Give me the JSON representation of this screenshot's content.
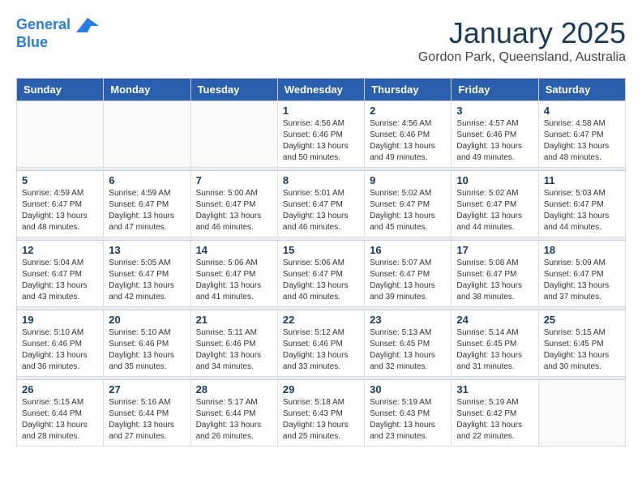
{
  "logo": {
    "line1": "General",
    "line2": "Blue"
  },
  "title": "January 2025",
  "subtitle": "Gordon Park, Queensland, Australia",
  "days_of_week": [
    "Sunday",
    "Monday",
    "Tuesday",
    "Wednesday",
    "Thursday",
    "Friday",
    "Saturday"
  ],
  "weeks": [
    [
      {
        "day": "",
        "info": ""
      },
      {
        "day": "",
        "info": ""
      },
      {
        "day": "",
        "info": ""
      },
      {
        "day": "1",
        "info": "Sunrise: 4:56 AM\nSunset: 6:46 PM\nDaylight: 13 hours\nand 50 minutes."
      },
      {
        "day": "2",
        "info": "Sunrise: 4:56 AM\nSunset: 6:46 PM\nDaylight: 13 hours\nand 49 minutes."
      },
      {
        "day": "3",
        "info": "Sunrise: 4:57 AM\nSunset: 6:46 PM\nDaylight: 13 hours\nand 49 minutes."
      },
      {
        "day": "4",
        "info": "Sunrise: 4:58 AM\nSunset: 6:47 PM\nDaylight: 13 hours\nand 48 minutes."
      }
    ],
    [
      {
        "day": "5",
        "info": "Sunrise: 4:59 AM\nSunset: 6:47 PM\nDaylight: 13 hours\nand 48 minutes."
      },
      {
        "day": "6",
        "info": "Sunrise: 4:59 AM\nSunset: 6:47 PM\nDaylight: 13 hours\nand 47 minutes."
      },
      {
        "day": "7",
        "info": "Sunrise: 5:00 AM\nSunset: 6:47 PM\nDaylight: 13 hours\nand 46 minutes."
      },
      {
        "day": "8",
        "info": "Sunrise: 5:01 AM\nSunset: 6:47 PM\nDaylight: 13 hours\nand 46 minutes."
      },
      {
        "day": "9",
        "info": "Sunrise: 5:02 AM\nSunset: 6:47 PM\nDaylight: 13 hours\nand 45 minutes."
      },
      {
        "day": "10",
        "info": "Sunrise: 5:02 AM\nSunset: 6:47 PM\nDaylight: 13 hours\nand 44 minutes."
      },
      {
        "day": "11",
        "info": "Sunrise: 5:03 AM\nSunset: 6:47 PM\nDaylight: 13 hours\nand 44 minutes."
      }
    ],
    [
      {
        "day": "12",
        "info": "Sunrise: 5:04 AM\nSunset: 6:47 PM\nDaylight: 13 hours\nand 43 minutes."
      },
      {
        "day": "13",
        "info": "Sunrise: 5:05 AM\nSunset: 6:47 PM\nDaylight: 13 hours\nand 42 minutes."
      },
      {
        "day": "14",
        "info": "Sunrise: 5:06 AM\nSunset: 6:47 PM\nDaylight: 13 hours\nand 41 minutes."
      },
      {
        "day": "15",
        "info": "Sunrise: 5:06 AM\nSunset: 6:47 PM\nDaylight: 13 hours\nand 40 minutes."
      },
      {
        "day": "16",
        "info": "Sunrise: 5:07 AM\nSunset: 6:47 PM\nDaylight: 13 hours\nand 39 minutes."
      },
      {
        "day": "17",
        "info": "Sunrise: 5:08 AM\nSunset: 6:47 PM\nDaylight: 13 hours\nand 38 minutes."
      },
      {
        "day": "18",
        "info": "Sunrise: 5:09 AM\nSunset: 6:47 PM\nDaylight: 13 hours\nand 37 minutes."
      }
    ],
    [
      {
        "day": "19",
        "info": "Sunrise: 5:10 AM\nSunset: 6:46 PM\nDaylight: 13 hours\nand 36 minutes."
      },
      {
        "day": "20",
        "info": "Sunrise: 5:10 AM\nSunset: 6:46 PM\nDaylight: 13 hours\nand 35 minutes."
      },
      {
        "day": "21",
        "info": "Sunrise: 5:11 AM\nSunset: 6:46 PM\nDaylight: 13 hours\nand 34 minutes."
      },
      {
        "day": "22",
        "info": "Sunrise: 5:12 AM\nSunset: 6:46 PM\nDaylight: 13 hours\nand 33 minutes."
      },
      {
        "day": "23",
        "info": "Sunrise: 5:13 AM\nSunset: 6:45 PM\nDaylight: 13 hours\nand 32 minutes."
      },
      {
        "day": "24",
        "info": "Sunrise: 5:14 AM\nSunset: 6:45 PM\nDaylight: 13 hours\nand 31 minutes."
      },
      {
        "day": "25",
        "info": "Sunrise: 5:15 AM\nSunset: 6:45 PM\nDaylight: 13 hours\nand 30 minutes."
      }
    ],
    [
      {
        "day": "26",
        "info": "Sunrise: 5:15 AM\nSunset: 6:44 PM\nDaylight: 13 hours\nand 28 minutes."
      },
      {
        "day": "27",
        "info": "Sunrise: 5:16 AM\nSunset: 6:44 PM\nDaylight: 13 hours\nand 27 minutes."
      },
      {
        "day": "28",
        "info": "Sunrise: 5:17 AM\nSunset: 6:44 PM\nDaylight: 13 hours\nand 26 minutes."
      },
      {
        "day": "29",
        "info": "Sunrise: 5:18 AM\nSunset: 6:43 PM\nDaylight: 13 hours\nand 25 minutes."
      },
      {
        "day": "30",
        "info": "Sunrise: 5:19 AM\nSunset: 6:43 PM\nDaylight: 13 hours\nand 23 minutes."
      },
      {
        "day": "31",
        "info": "Sunrise: 5:19 AM\nSunset: 6:42 PM\nDaylight: 13 hours\nand 22 minutes."
      },
      {
        "day": "",
        "info": ""
      }
    ]
  ]
}
